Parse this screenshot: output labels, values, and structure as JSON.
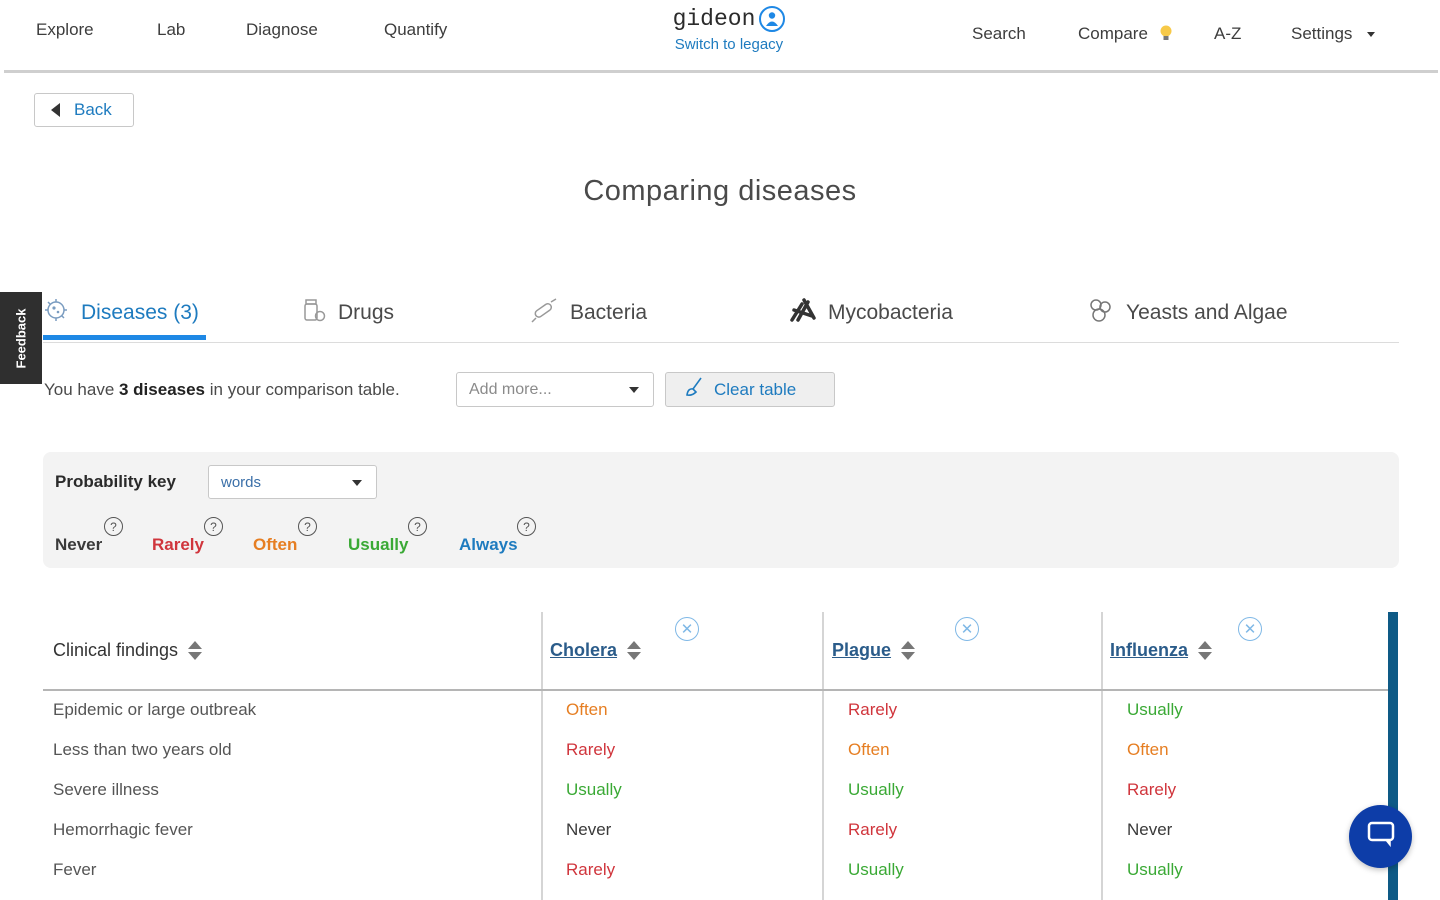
{
  "nav": {
    "left": [
      {
        "label": "Explore"
      },
      {
        "label": "Lab"
      },
      {
        "label": "Diagnose"
      },
      {
        "label": "Quantify"
      }
    ],
    "brand": {
      "name": "gideon",
      "legacy_link": "Switch to legacy"
    },
    "right": {
      "search": "Search",
      "compare": "Compare",
      "az": "A-Z",
      "settings": "Settings"
    }
  },
  "back_label": "Back",
  "page_title": "Comparing diseases",
  "feedback_label": "Feedback",
  "tabs": [
    {
      "label": "Diseases (3)",
      "icon": "virus-icon",
      "active": true
    },
    {
      "label": "Drugs",
      "icon": "pill-bottle-icon",
      "active": false
    },
    {
      "label": "Bacteria",
      "icon": "bacteria-icon",
      "active": false
    },
    {
      "label": "Mycobacteria",
      "icon": "mycobacteria-icon",
      "active": false
    },
    {
      "label": "Yeasts and Algae",
      "icon": "yeast-icon",
      "active": false
    }
  ],
  "summary": {
    "prefix": "You have ",
    "count": "3 diseases",
    "suffix": " in your comparison table."
  },
  "add_more_placeholder": "Add more...",
  "clear_table_label": "Clear table",
  "probability_key": {
    "label": "Probability key",
    "selected": "words",
    "levels": [
      {
        "label": "Never",
        "color": "#3a3a3a"
      },
      {
        "label": "Rarely",
        "color": "#d0353c"
      },
      {
        "label": "Often",
        "color": "#e67e22"
      },
      {
        "label": "Usually",
        "color": "#3aa935"
      },
      {
        "label": "Always",
        "color": "#1e7bbf"
      }
    ],
    "help_glyph": "?"
  },
  "table": {
    "header_findings": "Clinical findings",
    "diseases": [
      "Cholera",
      "Plague",
      "Influenza"
    ],
    "rows": [
      {
        "finding": "Epidemic or large outbreak",
        "values": [
          "Often",
          "Rarely",
          "Usually"
        ]
      },
      {
        "finding": "Less than two years old",
        "values": [
          "Rarely",
          "Often",
          "Often"
        ]
      },
      {
        "finding": "Severe illness",
        "values": [
          "Usually",
          "Usually",
          "Rarely"
        ]
      },
      {
        "finding": "Hemorrhagic fever",
        "values": [
          "Never",
          "Rarely",
          "Never"
        ]
      },
      {
        "finding": "Fever",
        "values": [
          "Rarely",
          "Usually",
          "Usually"
        ]
      }
    ]
  },
  "colors": {
    "accent": "#1e88e5",
    "link": "#1e7bbf",
    "chat_button": "#0d3da8",
    "scrollbar": "#0e5a86"
  }
}
